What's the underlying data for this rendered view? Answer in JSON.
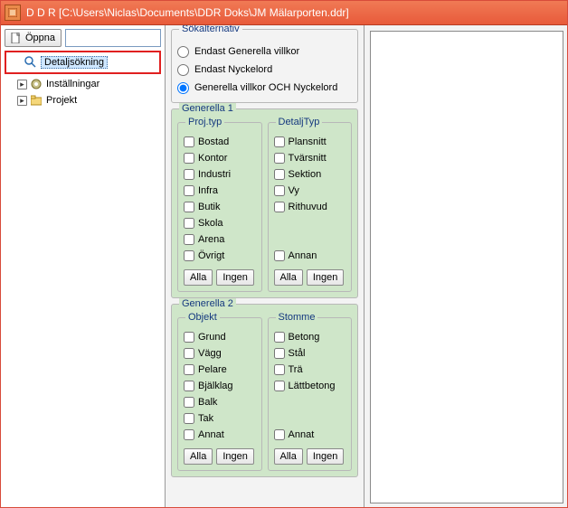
{
  "title": "D D R  [C:\\Users\\Niclas\\Documents\\DDR Doks\\JM Mälarporten.ddr]",
  "toolbar": {
    "open": "Öppna"
  },
  "tree": {
    "detail_search": "Detaljsökning",
    "settings": "Inställningar",
    "project": "Projekt"
  },
  "search": {
    "group": "Sökalternativ",
    "opt_general_only": "Endast Generella villkor",
    "opt_keyword_only": "Endast Nyckelord",
    "opt_both": "Generella villkor OCH Nyckelord"
  },
  "buttons": {
    "all": "Alla",
    "none": "Ingen"
  },
  "gen1": {
    "group": "Generella 1",
    "projtyp": {
      "label": "Proj.typ",
      "items": [
        "Bostad",
        "Kontor",
        "Industri",
        "Infra",
        "Butik",
        "Skola",
        "Arena",
        "Övrigt"
      ]
    },
    "detaljtyp": {
      "label": "DetaljTyp",
      "items": [
        "Plansnitt",
        "Tvärsnitt",
        "Sektion",
        "Vy",
        "Rithuvud"
      ],
      "other": "Annan"
    }
  },
  "gen2": {
    "group": "Generella 2",
    "objekt": {
      "label": "Objekt",
      "items": [
        "Grund",
        "Vägg",
        "Pelare",
        "Bjälklag",
        "Balk",
        "Tak",
        "Annat"
      ]
    },
    "stomme": {
      "label": "Stomme",
      "items": [
        "Betong",
        "Stål",
        "Trä",
        "Lättbetong"
      ],
      "other": "Annat"
    }
  }
}
